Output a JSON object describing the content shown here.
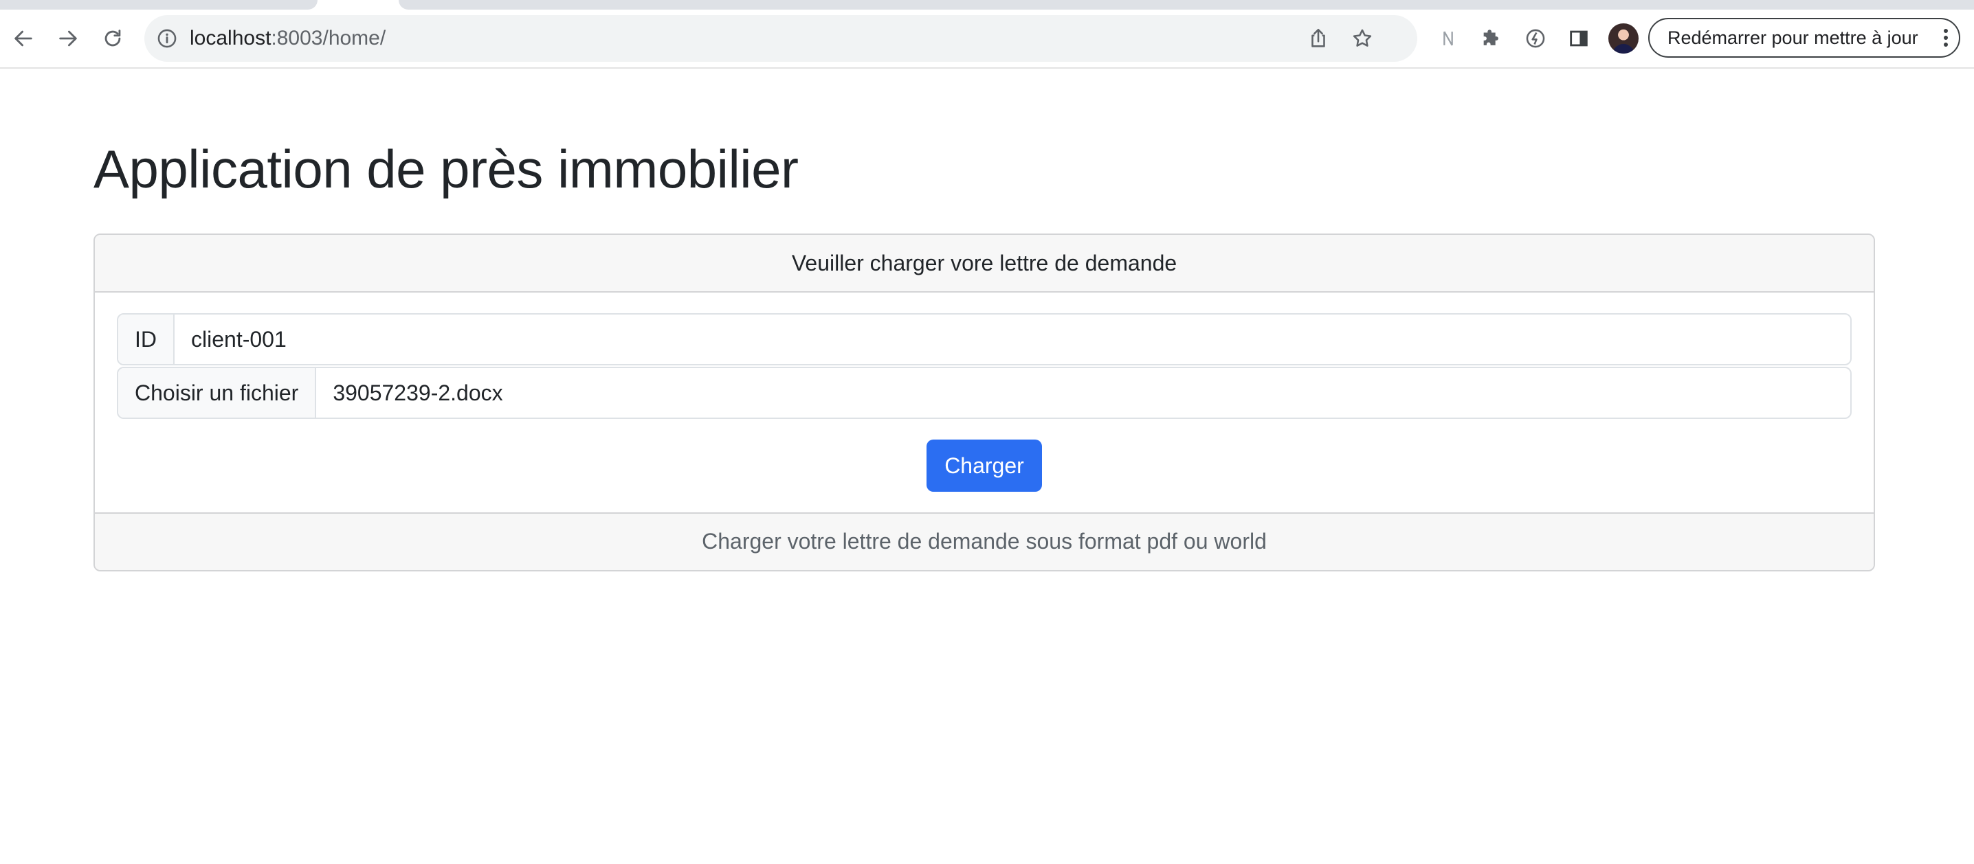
{
  "browser": {
    "url_host": "localhost",
    "url_rest": ":8003/home/",
    "update_button_label": "Redémarrer pour mettre à jour",
    "icons": [
      "back-icon",
      "forward-icon",
      "reload-icon",
      "site-info-icon",
      "share-icon",
      "bookmark-star-icon",
      "extension-n-icon",
      "puzzle-extensions-icon",
      "performance-icon",
      "side-panel-icon",
      "profile-avatar",
      "more-menu-icon"
    ]
  },
  "page": {
    "title": "Application de près immobilier"
  },
  "card": {
    "header": "Veuiller charger vore lettre de demande",
    "id_label": "ID",
    "id_value": "client-001",
    "file_label": "Choisir un fichier",
    "file_value": "39057239-2.docx",
    "submit_label": "Charger",
    "footer": "Charger votre lettre de demande sous format pdf ou world"
  },
  "colors": {
    "primary_button": "#2b6ef2",
    "card_header_bg": "#f7f7f7",
    "text": "#212529"
  }
}
